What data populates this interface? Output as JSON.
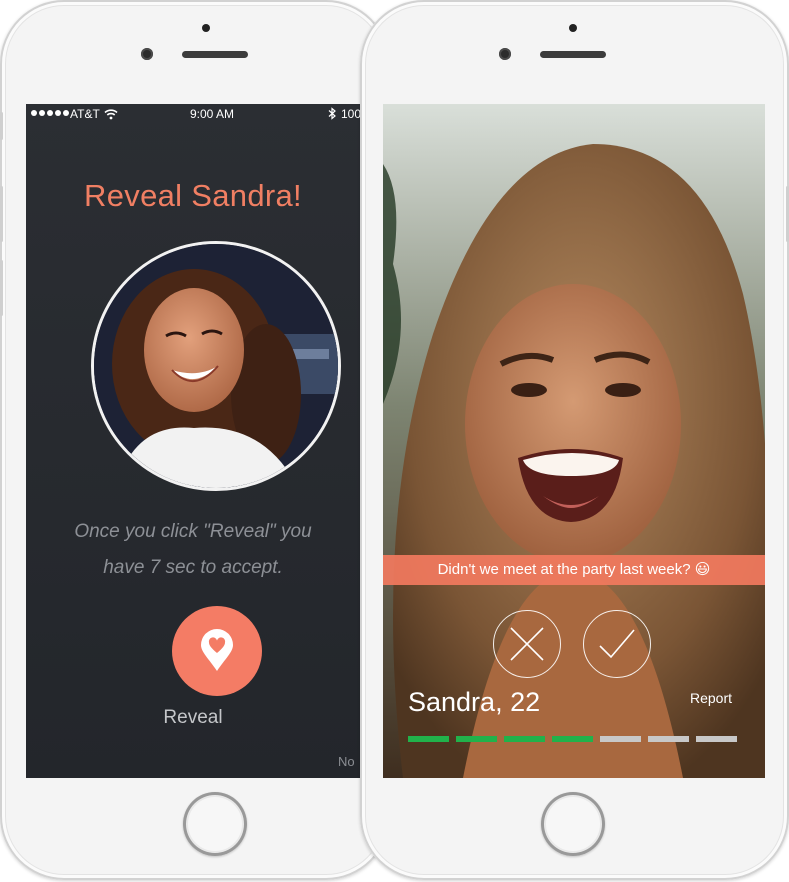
{
  "reveal_screen": {
    "status_bar": {
      "carrier": "AT&T",
      "time": "9:00 AM",
      "battery": "100"
    },
    "title": "Reveal Sandra!",
    "hint_line1": "Once you click \"Reveal\" you",
    "hint_line2": "have 7 sec to accept.",
    "reveal_button_label": "Reveal",
    "corner_text": "No",
    "icons": [
      "wifi-icon",
      "bluetooth-icon",
      "location-heart-icon"
    ]
  },
  "profile_screen": {
    "message": "Didn't we meet at the party last week? 😃",
    "name_age": "Sandra, 22",
    "report_label": "Report",
    "icons": [
      "close-icon",
      "check-icon"
    ],
    "timer": {
      "total_segments": 7,
      "elapsed_segments": 4
    }
  },
  "colors": {
    "accent": "#f47c65",
    "title": "#f07f63",
    "screen_background": "#272a2f",
    "progress_active": "#21b24b",
    "progress_inactive": "#c8c8c8"
  }
}
